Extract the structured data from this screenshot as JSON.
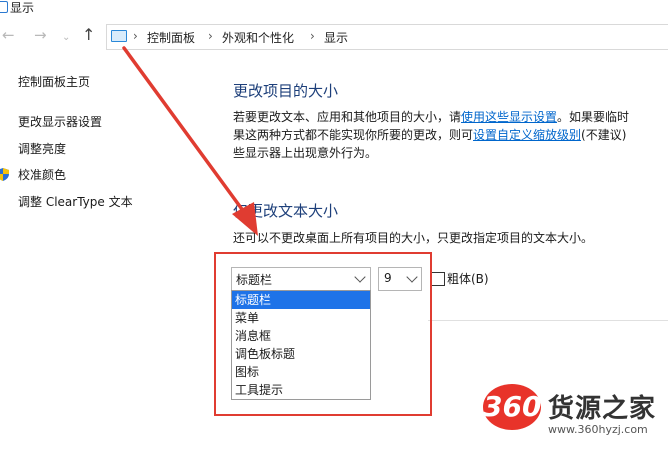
{
  "window": {
    "title": "显示"
  },
  "nav": {
    "back_icon": "←",
    "forward_icon": "→",
    "recent_icon": "⌄",
    "up_icon": "↑",
    "breadcrumbs": [
      "控制面板",
      "外观和个性化",
      "显示"
    ],
    "separator": "›"
  },
  "sidebar": {
    "items": [
      {
        "label": "控制面板主页"
      },
      {
        "label": "更改显示器设置"
      },
      {
        "label": "调整亮度"
      },
      {
        "label": "校准颜色"
      },
      {
        "label": "调整 ClearType 文本"
      }
    ]
  },
  "main": {
    "section1": {
      "heading": "更改项目的大小",
      "line1_a": "若要更改文本、应用和其他项目的大小，请",
      "line1_link": "使用这些显示设置",
      "line1_b": "。如果要临时",
      "line2_a": "果这两种方式都不能实现你所要的更改，则可",
      "line2_link": "设置自定义缩放级别",
      "line2_b": "(不建议)",
      "line3": "些显示器上出现意外行为。"
    },
    "section2": {
      "heading": "仅更改文本大小",
      "description": "还可以不更改桌面上所有项目的大小，只更改指定项目的文本大小。",
      "item_select": {
        "value": "标题栏",
        "options": [
          "标题栏",
          "菜单",
          "消息框",
          "调色板标题",
          "图标",
          "工具提示"
        ],
        "selected_index": 0
      },
      "size_select": {
        "value": "9"
      },
      "bold_checkbox": {
        "label": "粗体(B)",
        "checked": false
      }
    }
  },
  "watermark": {
    "logo_text": "360",
    "name": "货源之家",
    "url": "www.360hyzj.com"
  },
  "colors": {
    "heading": "#1d3f7a",
    "link": "#0066cc",
    "selection": "#1e73e8",
    "annotation": "#e03c31"
  }
}
